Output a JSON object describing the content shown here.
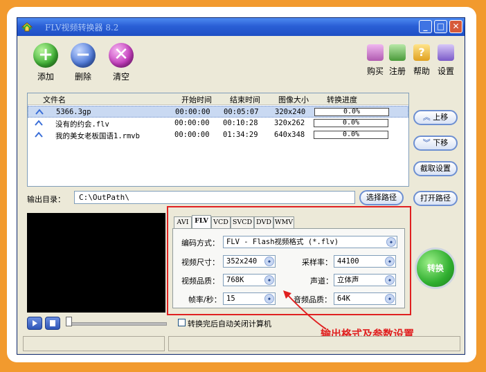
{
  "window": {
    "title": "FLV视频转换器 8.2"
  },
  "toolbar": {
    "add_label": "添加",
    "delete_label": "删除",
    "clear_label": "清空",
    "buy_label": "购买",
    "register_label": "注册",
    "help_label": "帮助",
    "settings_label": "设置"
  },
  "file_list": {
    "columns": [
      "文件名",
      "开始时间",
      "结束时间",
      "图像大小",
      "转换进度"
    ],
    "rows": [
      {
        "name": "5366.3gp",
        "start": "00:00:00",
        "end": "00:05:07",
        "size": "320x240",
        "progress": "0.0%"
      },
      {
        "name": "没有的约会.flv",
        "start": "00:00:00",
        "end": "00:10:28",
        "size": "320x262",
        "progress": "0.0%"
      },
      {
        "name": "我的美女老板国语1.rmvb",
        "start": "00:00:00",
        "end": "01:34:29",
        "size": "640x348",
        "progress": "0.0%"
      }
    ]
  },
  "side_buttons": {
    "move_up": "上移",
    "move_down": "下移",
    "clip_settings": "截取设置",
    "open_path": "打开路径"
  },
  "output": {
    "label": "输出目录：",
    "path": "C:\\OutPath\\",
    "choose_path": "选择路径"
  },
  "format_tabs": [
    "AVI",
    "FLV",
    "VCD",
    "SVCD",
    "DVD",
    "WMV"
  ],
  "active_tab": "FLV",
  "settings": {
    "encoding_label": "编码方式：",
    "encoding_value": "FLV - Flash视频格式 (*.flv)",
    "video_size_label": "视频尺寸：",
    "video_size_value": "352x240",
    "video_quality_label": "视频品质：",
    "video_quality_value": "768K",
    "fps_label": "帧率/秒：",
    "fps_value": "15",
    "sample_rate_label": "采样率：",
    "sample_rate_value": "44100",
    "channel_label": "声道：",
    "channel_value": "立体声",
    "audio_quality_label": "音频品质：",
    "audio_quality_value": "64K"
  },
  "convert_label": "转换",
  "shutdown_label": "转换完后自动关闭计算机",
  "annotation": "输出格式及参数设置",
  "colors": {
    "accent": "#f29a2e",
    "highlight_box": "#e02020",
    "titlebar": "#2a5fd6"
  }
}
